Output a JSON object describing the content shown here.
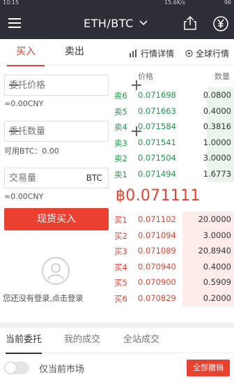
{
  "status_bar": {
    "time": "10:15",
    "network": "15.6K/s",
    "battery": "96"
  },
  "header": {
    "title": "ETH/BTC",
    "title_icon": "chevron-down-icon",
    "share_icon": "share-icon",
    "currency_icon": "currency-icon",
    "menu_icon": "menu-icon"
  },
  "trade_tabs": {
    "buy": "买入",
    "sell": "卖出",
    "market_detail": "行情详情",
    "all_markets": "全球行情"
  },
  "form": {
    "price_placeholder": "委托价格",
    "price_cny": "≈0.00CNY",
    "amount_placeholder": "委托数量",
    "available": "可用BTC：0.00",
    "volume_placeholder": "交易量",
    "volume_unit": "BTC",
    "volume_cny": "≈0.00CNY",
    "submit": "现货买入",
    "login_prompt": "您还没有登录,点击登录"
  },
  "order_book": {
    "price_header": "价格",
    "qty_header": "数量",
    "asks": [
      {
        "label": "卖6",
        "price": "0.071698",
        "qty": "0.0800",
        "depth": 0.22
      },
      {
        "label": "卖5",
        "price": "0.071663",
        "qty": "0.4000",
        "depth": 0.22
      },
      {
        "label": "卖4",
        "price": "0.071584",
        "qty": "0.3816",
        "depth": 0.22
      },
      {
        "label": "卖3",
        "price": "0.071541",
        "qty": "1.0000",
        "depth": 0.22
      },
      {
        "label": "卖2",
        "price": "0.071504",
        "qty": "3.0000",
        "depth": 0.22
      },
      {
        "label": "卖1",
        "price": "0.071494",
        "qty": "1.6773",
        "depth": 0.22
      }
    ],
    "last_price": "฿0.071111",
    "bids": [
      {
        "label": "买1",
        "price": "0.071102",
        "qty": "20.0000",
        "depth": 0.42
      },
      {
        "label": "买2",
        "price": "0.071094",
        "qty": "3.0000",
        "depth": 0.42
      },
      {
        "label": "买3",
        "price": "0.071089",
        "qty": "20.8940",
        "depth": 0.42
      },
      {
        "label": "买4",
        "price": "0.070940",
        "qty": "0.4000",
        "depth": 0.42
      },
      {
        "label": "买5",
        "price": "0.070900",
        "qty": "0.5909",
        "depth": 0.42
      },
      {
        "label": "买6",
        "price": "0.070829",
        "qty": "0.2000",
        "depth": 0.42
      }
    ]
  },
  "orders_tabs": [
    "当前委托",
    "我的成交",
    "全站成交"
  ],
  "bottom": {
    "toggle_label": "仅当前市场",
    "cancel_all": "全部撤销"
  },
  "colors": {
    "header_bg": "#2d2f36",
    "buy_red": "#e8412f",
    "sell_green": "#1f9a4a",
    "ask_depth": "#eaf6ec",
    "bid_depth": "#fdecea"
  }
}
